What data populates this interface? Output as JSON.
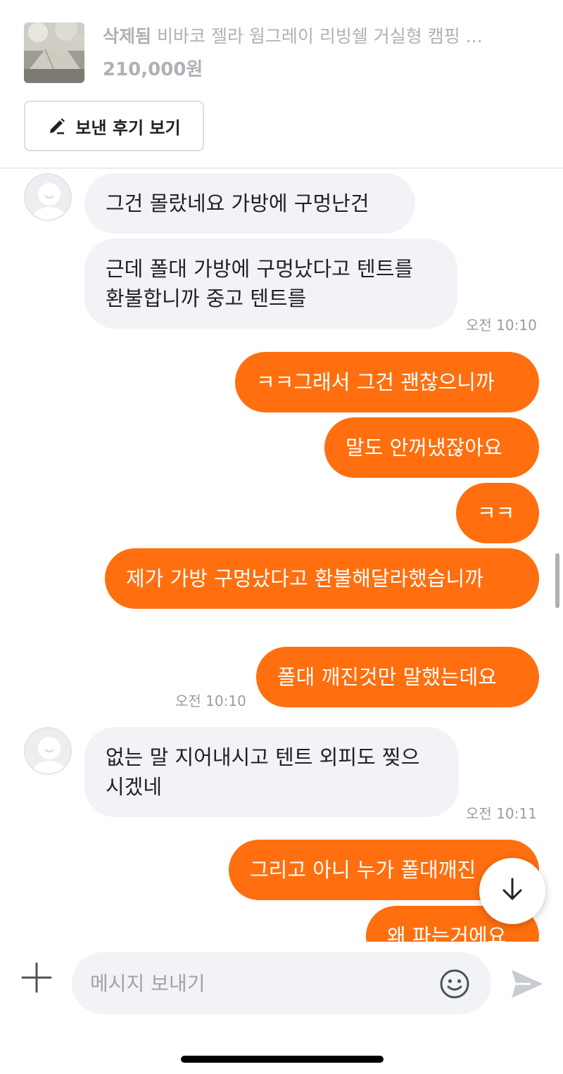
{
  "product": {
    "status": "삭제됨",
    "title": "비바코 젤라 웜그레이 리빙쉘 거실형 캠핑 ...",
    "price": "210,000원",
    "review_button": "보낸 후기 보기"
  },
  "messages": [
    {
      "side": "in",
      "text": "그건 몰랐네요 가방에 구멍난건"
    },
    {
      "side": "in",
      "text": "근데 폴대 가방에 구멍났다고 텐트를 환불합니까 중고 텐트를",
      "time": "오전 10:10"
    },
    {
      "side": "out",
      "text": "ㅋㅋ그래서 그건 괜찮으니까"
    },
    {
      "side": "out",
      "text": "말도 안꺼냈잖아요"
    },
    {
      "side": "out",
      "text": "ㅋㅋ"
    },
    {
      "side": "out",
      "text": "제가 가방 구멍났다고 환불해달라했습니까"
    },
    {
      "side": "out",
      "text": "폴대 깨진것만 말했는데요",
      "time": "오전 10:10"
    },
    {
      "side": "in",
      "text": "없는 말 지어내시고 텐트 외피도 찢으시겠네",
      "time": "오전 10:11"
    },
    {
      "side": "out",
      "text": "그리고 아니 누가 폴대깨진"
    },
    {
      "side": "out",
      "text": "왜 파는거에요"
    }
  ],
  "input": {
    "placeholder": "메시지 보내기"
  },
  "icons": {
    "add": "plus-icon",
    "emoji": "smiley-icon",
    "send": "send-icon",
    "scroll": "arrow-down-icon",
    "edit": "pencil-icon"
  },
  "colors": {
    "accent": "#ff6f0f",
    "incoming_bubble": "#f2f3f6",
    "muted_text": "#aeb1b6"
  }
}
